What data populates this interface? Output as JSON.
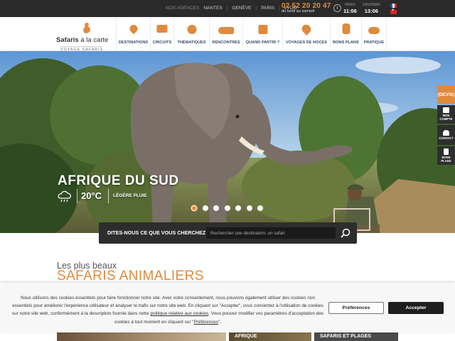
{
  "topbar": {
    "agencies_label": "NOS AGENCES",
    "cities": [
      "NANTES",
      "GENÈVE",
      "PARIS",
      "LYON"
    ],
    "phone": "02 52 20 20 47",
    "phone_hours": "du lundi au samedi",
    "timezones": [
      {
        "city": "PARIS",
        "time": "11:06"
      },
      {
        "city": "ZANZIBAR",
        "time": "13:06"
      }
    ],
    "icons": [
      "clock-icon",
      "flag-fr-icon",
      "flag-ch-icon"
    ]
  },
  "logo": {
    "brand_part1": "Safaris",
    "brand_part2": " à la carte",
    "tagline": "VOYAGE SAFARIS"
  },
  "nav": {
    "items": [
      {
        "label": "DESTINATIONS",
        "icon": "map-pin-icon"
      },
      {
        "label": "CIRCUITS",
        "icon": "map-icon"
      },
      {
        "label": "THÉMATIQUES",
        "icon": "compass-icon"
      },
      {
        "label": "RENCONTRES",
        "icon": "rhino-icon"
      },
      {
        "label": "QUAND PARTIR ?",
        "icon": "calendar-icon"
      },
      {
        "label": "VOYAGES DE NOCES",
        "icon": "hearts-icon"
      },
      {
        "label": "BONS PLANS",
        "icon": "thumbs-up-icon"
      },
      {
        "label": "PRATIQUE",
        "icon": "binoculars-icon"
      }
    ]
  },
  "hero": {
    "destination": "AFRIQUE DU SUD",
    "temperature": "20°C",
    "condition": "LÉGÈRE PLUIE",
    "slides_count": 7,
    "active_slide": 1
  },
  "side_tabs": {
    "devis": "DEVIS",
    "items": [
      {
        "label": "MON COMPTE",
        "icon": "lock-icon"
      },
      {
        "label": "CONTACT",
        "icon": "user-icon"
      },
      {
        "label": "BONS PLANS",
        "icon": "thumbs-up-icon"
      }
    ]
  },
  "search": {
    "label": "DITES-NOUS CE QUE VOUS CHERCHEZ !",
    "placeholder": "Rechercher une destination, un safari"
  },
  "section": {
    "pre_title": "Les plus beaux",
    "title": "SAFARIS ANIMALIERS"
  },
  "cards": [
    {
      "label": ""
    },
    {
      "label": "AFRIQUE"
    },
    {
      "label": "SAFARIS ET PLAGES"
    }
  ],
  "cookie": {
    "text_before_link1": "Nous utilisons des cookies essentiels pour faire fonctionner notre site. Avec votre consentement, nous pouvons également utiliser des cookies non essentiels pour améliorer l'expérience utilisateur et analyser le trafic sur notre site web. En cliquant sur \"Accepter\", vous consentez à l'utilisation de cookies sur notre site web, conformément à la description fournie dans notre ",
    "link1": "politique relative aux cookies",
    "text_between": ". Vous pouvez modifier vos paramètres d'acceptation des cookies à tout moment en cliquant sur \"",
    "link2": "Préférences",
    "text_after": "\".",
    "preferences_label": "Préférences",
    "accept_label": "Accepter"
  },
  "colors": {
    "accent": "#e08a3c",
    "dark": "#2a2a2a",
    "nav_text": "#3a4a6a"
  }
}
